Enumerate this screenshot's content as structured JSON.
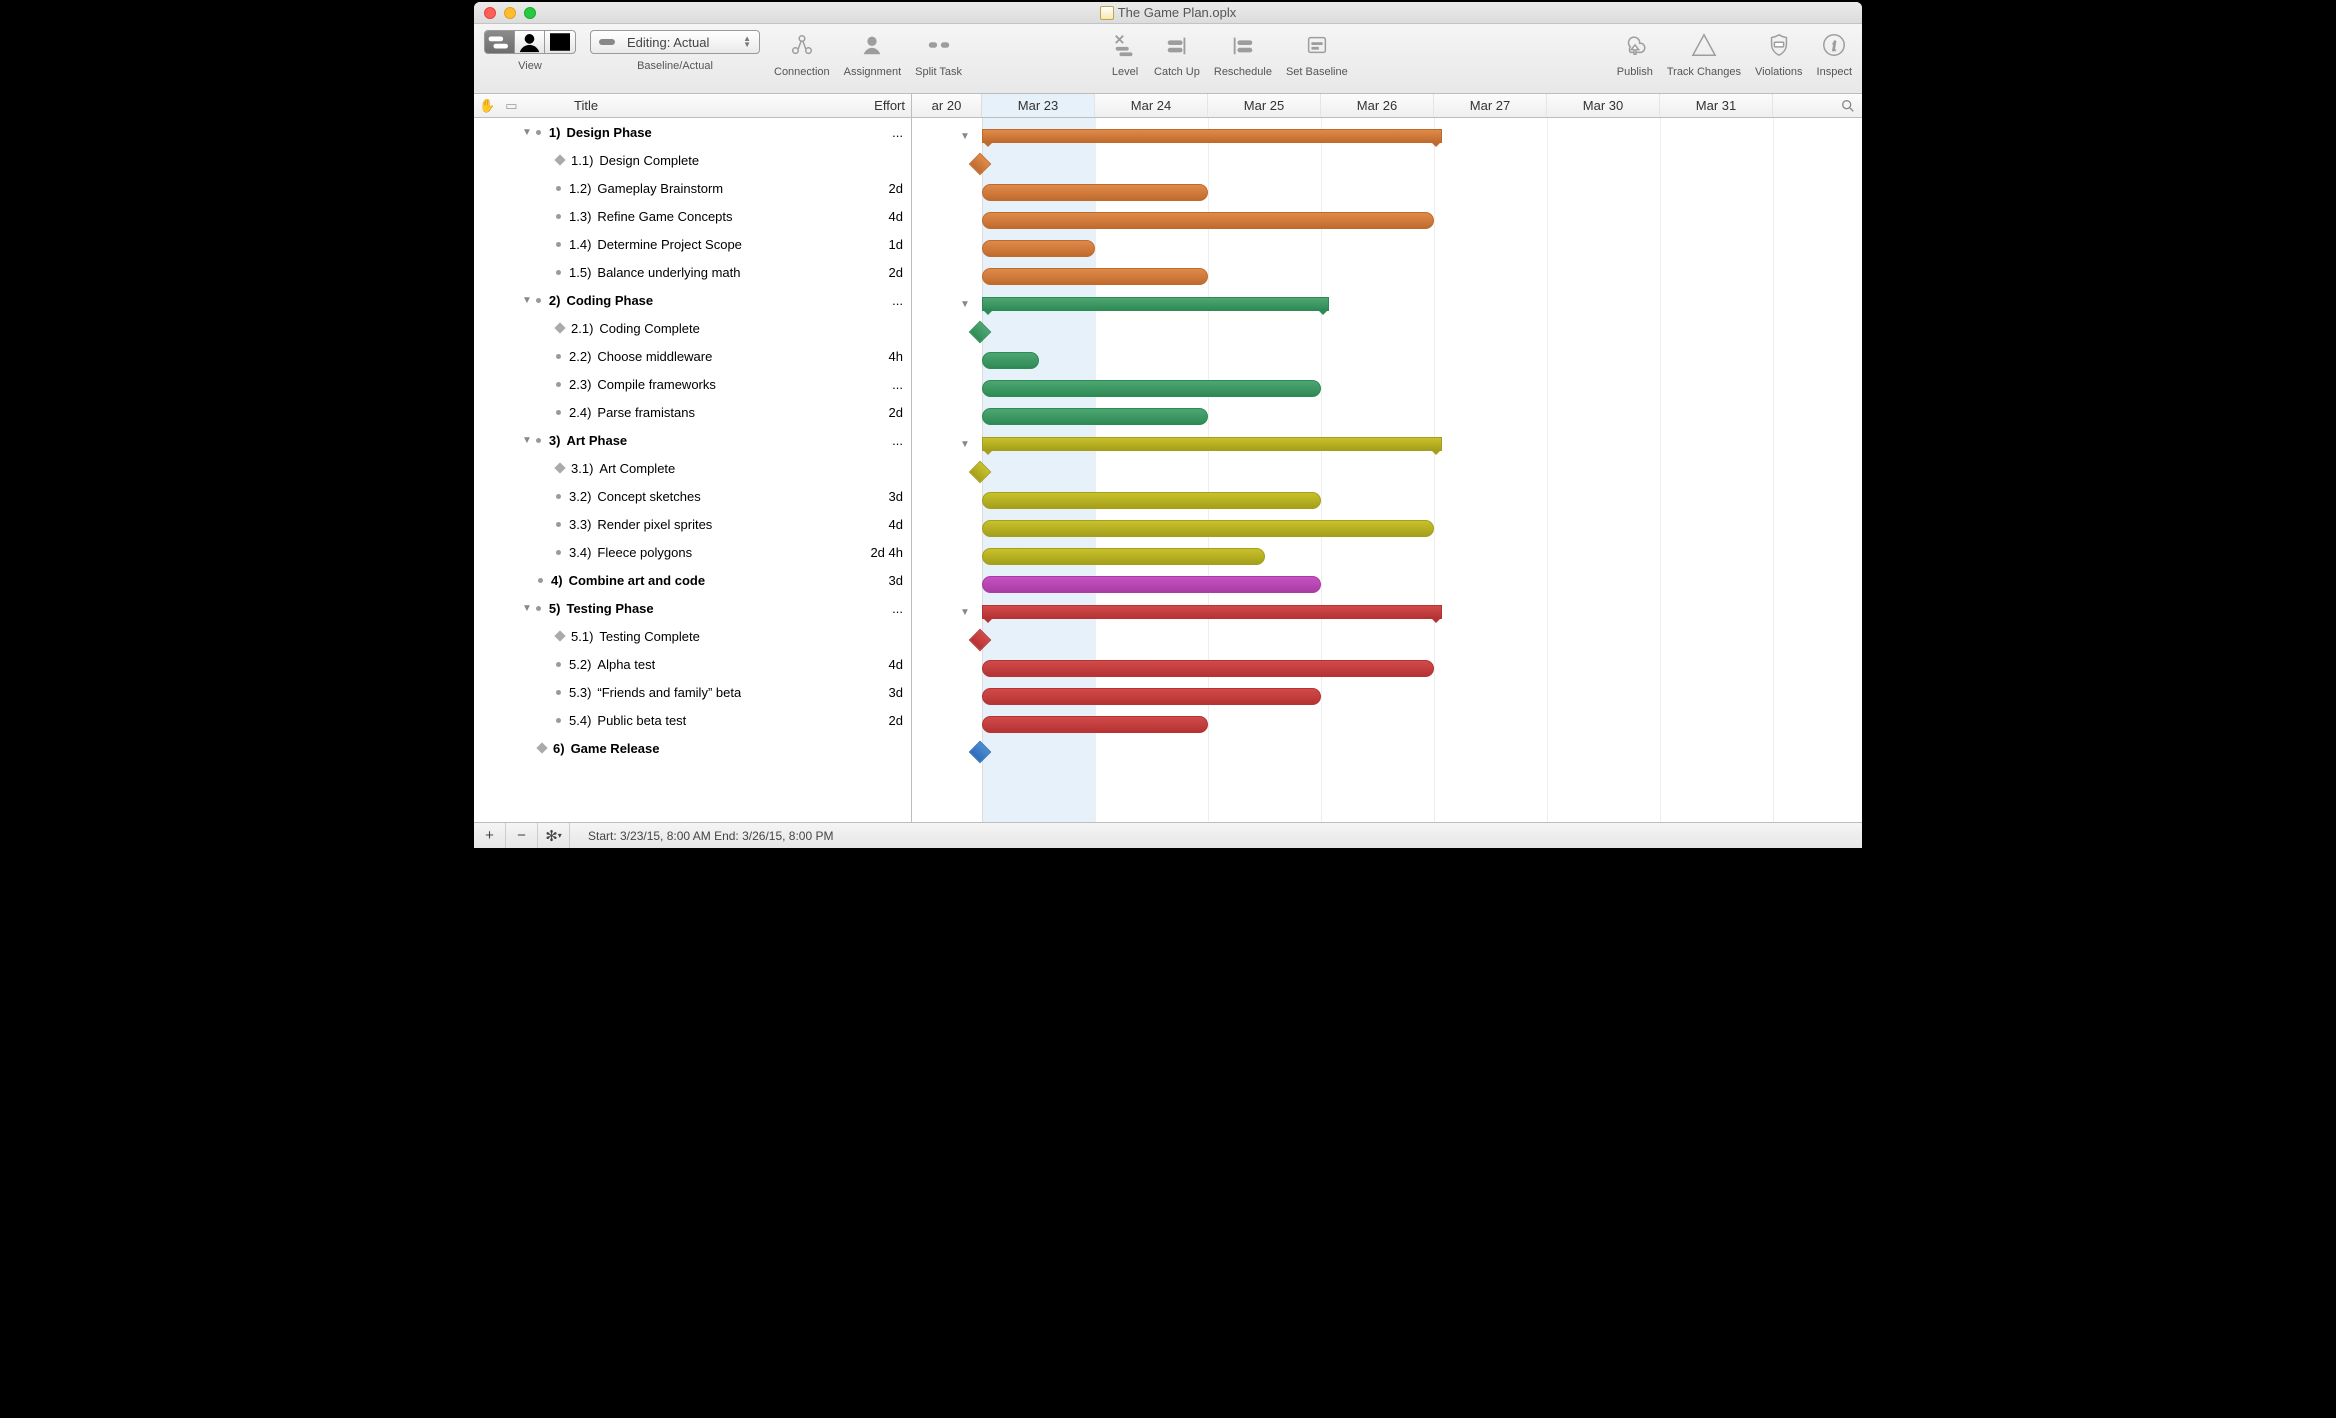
{
  "window": {
    "title": "The Game Plan.oplx"
  },
  "toolbar": {
    "view_label": "View",
    "combo_value": "Editing: Actual",
    "baseline_label": "Baseline/Actual",
    "items": [
      {
        "id": "connection",
        "label": "Connection"
      },
      {
        "id": "assignment",
        "label": "Assignment"
      },
      {
        "id": "split-task",
        "label": "Split Task"
      },
      {
        "id": "level",
        "label": "Level"
      },
      {
        "id": "catch-up",
        "label": "Catch Up"
      },
      {
        "id": "reschedule",
        "label": "Reschedule"
      },
      {
        "id": "set-baseline",
        "label": "Set Baseline"
      },
      {
        "id": "publish",
        "label": "Publish"
      },
      {
        "id": "track-changes",
        "label": "Track Changes"
      },
      {
        "id": "violations",
        "label": "Violations"
      },
      {
        "id": "inspect",
        "label": "Inspect"
      }
    ]
  },
  "columns": {
    "title": "Title",
    "effort": "Effort"
  },
  "timeline": {
    "day0_label": "ar 20",
    "days": [
      "Mar 23",
      "Mar 24",
      "Mar 25",
      "Mar 26",
      "Mar 27",
      "Mar 30",
      "Mar 31"
    ],
    "selected_index": 0
  },
  "tasks": [
    {
      "depth": 0,
      "type": "summary",
      "num": "1)",
      "title": "Design Phase",
      "effort": "...",
      "color": "orange",
      "start": 0,
      "days": 4
    },
    {
      "depth": 1,
      "type": "milestone",
      "num": "1.1)",
      "title": "Design Complete",
      "effort": "",
      "color": "orange",
      "start": 0
    },
    {
      "depth": 1,
      "type": "task",
      "num": "1.2)",
      "title": "Gameplay Brainstorm",
      "effort": "2d",
      "color": "orange",
      "start": 0,
      "days": 2
    },
    {
      "depth": 1,
      "type": "task",
      "num": "1.3)",
      "title": "Refine Game Concepts",
      "effort": "4d",
      "color": "orange",
      "start": 0,
      "days": 4
    },
    {
      "depth": 1,
      "type": "task",
      "num": "1.4)",
      "title": "Determine Project Scope",
      "effort": "1d",
      "color": "orange",
      "start": 0,
      "days": 1
    },
    {
      "depth": 1,
      "type": "task",
      "num": "1.5)",
      "title": "Balance underlying math",
      "effort": "2d",
      "color": "orange",
      "start": 0,
      "days": 2
    },
    {
      "depth": 0,
      "type": "summary",
      "num": "2)",
      "title": "Coding Phase",
      "effort": "...",
      "color": "green",
      "start": 0,
      "days": 3
    },
    {
      "depth": 1,
      "type": "milestone",
      "num": "2.1)",
      "title": "Coding Complete",
      "effort": "",
      "color": "green",
      "start": 0
    },
    {
      "depth": 1,
      "type": "task",
      "num": "2.2)",
      "title": "Choose middleware",
      "effort": "4h",
      "color": "green",
      "start": 0,
      "days": 0.5
    },
    {
      "depth": 1,
      "type": "task",
      "num": "2.3)",
      "title": "Compile frameworks",
      "effort": "...",
      "color": "green",
      "start": 0,
      "days": 3
    },
    {
      "depth": 1,
      "type": "task",
      "num": "2.4)",
      "title": "Parse framistans",
      "effort": "2d",
      "color": "green",
      "start": 0,
      "days": 2
    },
    {
      "depth": 0,
      "type": "summary",
      "num": "3)",
      "title": "Art Phase",
      "effort": "...",
      "color": "yellow",
      "start": 0,
      "days": 4
    },
    {
      "depth": 1,
      "type": "milestone",
      "num": "3.1)",
      "title": "Art Complete",
      "effort": "",
      "color": "yellow",
      "start": 0
    },
    {
      "depth": 1,
      "type": "task",
      "num": "3.2)",
      "title": "Concept sketches",
      "effort": "3d",
      "color": "yellow",
      "start": 0,
      "days": 3
    },
    {
      "depth": 1,
      "type": "task",
      "num": "3.3)",
      "title": "Render pixel sprites",
      "effort": "4d",
      "color": "yellow",
      "start": 0,
      "days": 4
    },
    {
      "depth": 1,
      "type": "task",
      "num": "3.4)",
      "title": "Fleece polygons",
      "effort": "2d 4h",
      "color": "yellow",
      "start": 0,
      "days": 2.5
    },
    {
      "depth": 0,
      "type": "task-bold",
      "num": "4)",
      "title": "Combine art and code",
      "effort": "3d",
      "color": "purple",
      "start": 0,
      "days": 3
    },
    {
      "depth": 0,
      "type": "summary",
      "num": "5)",
      "title": "Testing Phase",
      "effort": "...",
      "color": "red",
      "start": 0,
      "days": 4
    },
    {
      "depth": 1,
      "type": "milestone",
      "num": "5.1)",
      "title": "Testing Complete",
      "effort": "",
      "color": "red",
      "start": 0
    },
    {
      "depth": 1,
      "type": "task",
      "num": "5.2)",
      "title": "Alpha test",
      "effort": "4d",
      "color": "red",
      "start": 0,
      "days": 4
    },
    {
      "depth": 1,
      "type": "task",
      "num": "5.3)",
      "title": "“Friends and family” beta",
      "effort": "3d",
      "color": "red",
      "start": 0,
      "days": 3
    },
    {
      "depth": 1,
      "type": "task",
      "num": "5.4)",
      "title": "Public beta test",
      "effort": "2d",
      "color": "red",
      "start": 0,
      "days": 2
    },
    {
      "depth": 0,
      "type": "milestone-bold",
      "num": "6)",
      "title": "Game Release",
      "effort": "",
      "color": "blue",
      "start": 0
    }
  ],
  "footer": {
    "status": "Start: 3/23/15, 8:00 AM End: 3/26/15, 8:00 PM"
  }
}
